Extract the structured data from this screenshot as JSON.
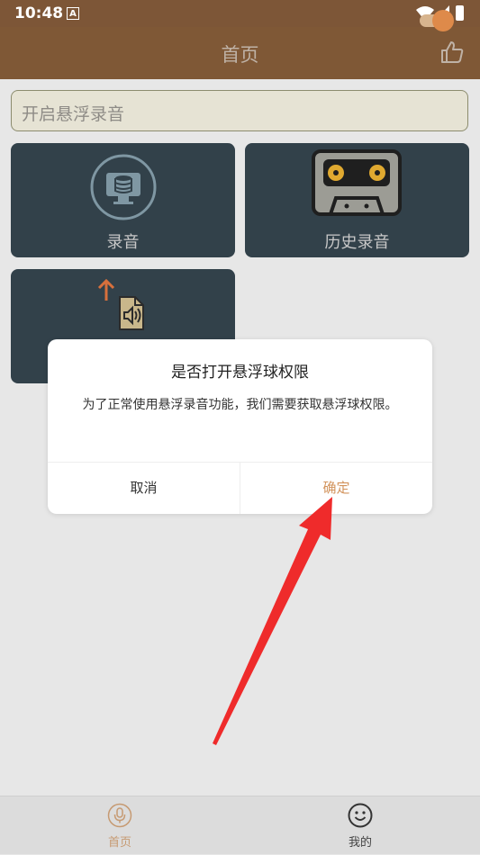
{
  "status_bar": {
    "time": "10:48",
    "badge": "A"
  },
  "header": {
    "title": "首页"
  },
  "toggle_row": {
    "label": "开启悬浮录音",
    "state": "on"
  },
  "cards": [
    {
      "label": "录音",
      "icon": "record-icon"
    },
    {
      "label": "历史录音",
      "icon": "cassette-icon"
    },
    {
      "label": "",
      "icon": "upload-audio-file-icon"
    }
  ],
  "dialog": {
    "title": "是否打开悬浮球权限",
    "message": "为了正常使用悬浮录音功能，我们需要获取悬浮球权限。",
    "cancel_label": "取消",
    "ok_label": "确定"
  },
  "bottom_nav": [
    {
      "label": "首页",
      "icon": "microphone-icon",
      "active": true
    },
    {
      "label": "我的",
      "icon": "smiley-icon",
      "active": false
    }
  ],
  "colors": {
    "header_bg": "#7f5836",
    "card_bg": "#32414a",
    "accent": "#d2935c",
    "arrow": "#ef2b2b"
  }
}
